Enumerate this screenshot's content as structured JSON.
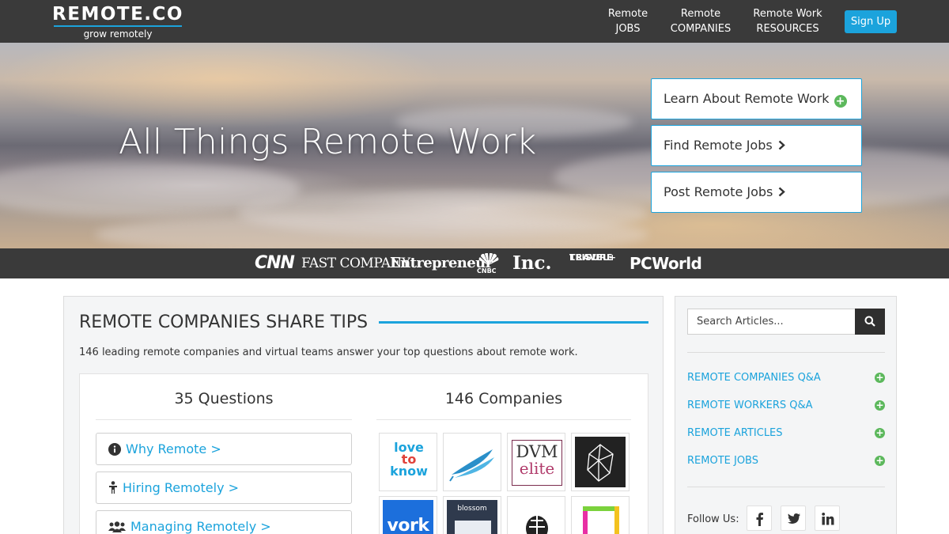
{
  "nav": {
    "logo": "REMOTE.CO",
    "tagline": "grow remotely",
    "links": [
      {
        "line1": "Remote",
        "line2": "JOBS"
      },
      {
        "line1": "Remote",
        "line2": "COMPANIES"
      },
      {
        "line1": "Remote Work",
        "line2": "RESOURCES"
      }
    ],
    "signup": "Sign Up"
  },
  "hero": {
    "title": "All Things Remote Work",
    "buttons": [
      {
        "label": "Learn About Remote Work",
        "icon": "plus-circle-icon"
      },
      {
        "label": "Find Remote Jobs",
        "icon": "chevron-right-icon"
      },
      {
        "label": "Post Remote Jobs",
        "icon": "chevron-right-icon"
      }
    ]
  },
  "press": {
    "cnn": "CNN",
    "fastcompany": "FAST COMPANY",
    "entrepreneur": "Entrepreneur",
    "cnbc": "CNBC",
    "inc": "Inc.",
    "travel_leisure_1": "TRAVEL+",
    "travel_leisure_2": "LEISURE",
    "pcworld": "PCWorld"
  },
  "main": {
    "title": "REMOTE COMPANIES SHARE TIPS",
    "intro": "146 leading remote companies and virtual teams answer your top questions about remote work.",
    "questions_heading": "35 Questions",
    "companies_heading": "146 Companies",
    "questions": [
      {
        "label": "Why Remote >",
        "icon": "info-circle-icon"
      },
      {
        "label": "Hiring Remotely >",
        "icon": "person-icon"
      },
      {
        "label": "Managing Remotely >",
        "icon": "users-icon"
      }
    ],
    "company_logos": [
      {
        "name": "love to know",
        "icon": "lovetoknow-logo"
      },
      {
        "name": "feather",
        "icon": "feather-logo"
      },
      {
        "name": "DVM elite",
        "icon": "dvm-elite-logo"
      },
      {
        "name": "crystal",
        "icon": "crystal-logo"
      },
      {
        "name": "vork",
        "icon": "vork-logo"
      },
      {
        "name": "blossom",
        "icon": "blossom-logo"
      },
      {
        "name": "helmet",
        "icon": "helmet-logo"
      },
      {
        "name": "frame",
        "icon": "frame-logo"
      }
    ],
    "logo_text": {
      "love": "love",
      "to": "to",
      "know": "know",
      "dvm": "DVM",
      "elite": "elite",
      "vork": "vork",
      "blossom": "blossom"
    }
  },
  "sidebar": {
    "search_placeholder": "Search Articles...",
    "links": [
      "REMOTE COMPANIES Q&A",
      "REMOTE WORKERS Q&A",
      "REMOTE ARTICLES",
      "REMOTE JOBS"
    ],
    "follow_label": "Follow Us:",
    "social": [
      "facebook-icon",
      "twitter-icon",
      "linkedin-icon"
    ]
  },
  "colors": {
    "accent": "#1ba3dc",
    "nav_bg": "#3a3a3a",
    "plus_green": "#5cb85c"
  }
}
